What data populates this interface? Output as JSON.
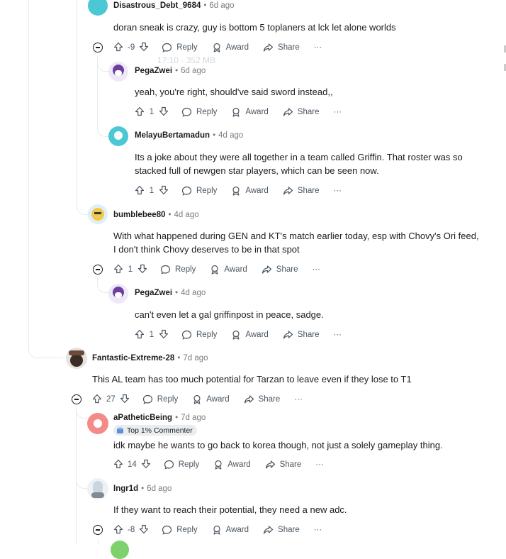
{
  "actions": {
    "reply": "Reply",
    "award": "Award",
    "share": "Share",
    "more": "···"
  },
  "comments": [
    {
      "user": "Disastrous_Debt_9684",
      "sep": "•",
      "time": "6d ago",
      "text": "doran sneak is crazy, guy is bottom 5 toplaners at lck let alone worlds",
      "votes": "-9",
      "avatar_color": "#4cc7d4"
    },
    {
      "user": "PegaZwei",
      "sep": "•",
      "time": "6d ago",
      "text": "yeah, you're right, should've said sword instead,,",
      "votes": "1",
      "avatar_color": "#6c3fa0"
    },
    {
      "user": "MelayuBertamadun",
      "sep": "•",
      "time": "4d ago",
      "text_lines": [
        "Its a joke about they were all together in a team called Griffin. That roster was so",
        "stacked full of newgen star players, which can be seen now."
      ],
      "votes": "1",
      "avatar_color": "#4cc7d4"
    },
    {
      "user": "bumblebee80",
      "sep": "•",
      "time": "4d ago",
      "text_lines": [
        "With what happened during GEN and KT's match earlier today, esp with Chovy's Ori feed,",
        "I don't think Chovy deserves to be in that spot"
      ],
      "votes": "1",
      "avatar_color": "#f2c94c"
    },
    {
      "user": "PegaZwei",
      "sep": "•",
      "time": "4d ago",
      "text": "can't even let a gal griffinpost in peace, sadge.",
      "votes": "1",
      "avatar_color": "#6c3fa0"
    },
    {
      "user": "Fantastic-Extreme-28",
      "sep": "•",
      "time": "7d ago",
      "text": "This AL team has too much potential for Tarzan to leave even if they lose to T1",
      "votes": "27",
      "avatar_color": "#3a2c26"
    },
    {
      "user": "aPatheticBeing",
      "sep": "•",
      "time": "7d ago",
      "badge": "Top 1% Commenter",
      "text": "idk maybe he wants to go back to korea though, not just a solely gameplay thing.",
      "votes": "14",
      "avatar_color": "#f58a8a"
    },
    {
      "user": "Ingr1d",
      "sep": "•",
      "time": "6d ago",
      "text": "If they want to reach their potential, they need a new adc.",
      "votes": "-8",
      "avatar_color": "#c9d6e0"
    }
  ],
  "ghost_text": "17:10 · 352 MB"
}
